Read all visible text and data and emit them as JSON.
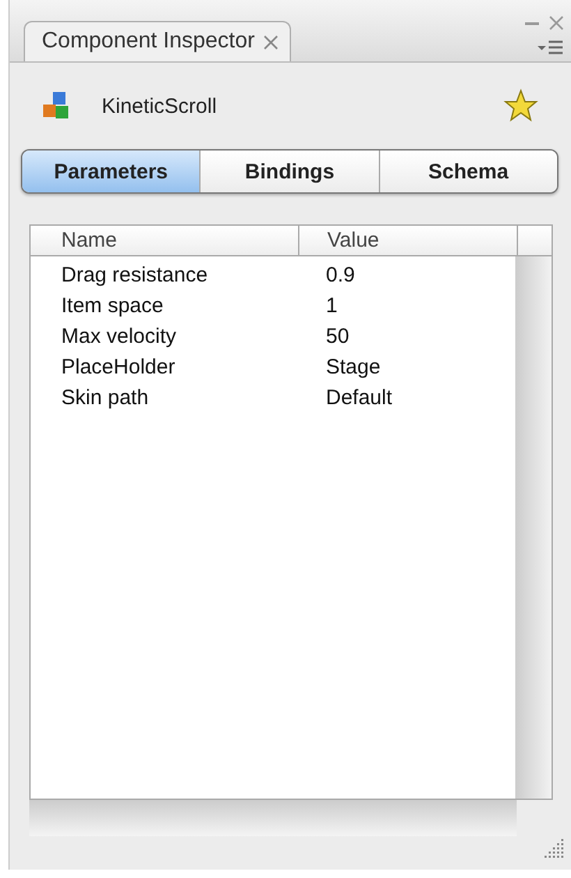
{
  "panel": {
    "tab": "Component Inspector"
  },
  "component": {
    "name": "KineticScroll"
  },
  "tabs": [
    {
      "label": "Parameters",
      "selected": true
    },
    {
      "label": "Bindings",
      "selected": false
    },
    {
      "label": "Schema",
      "selected": false
    }
  ],
  "table": {
    "columns": [
      "Name",
      "Value"
    ],
    "rows": [
      {
        "name": "Drag resistance",
        "value": "0.9"
      },
      {
        "name": "Item space",
        "value": "1"
      },
      {
        "name": "Max velocity",
        "value": "50"
      },
      {
        "name": "PlaceHolder",
        "value": "Stage"
      },
      {
        "name": "Skin path",
        "value": "Default"
      }
    ]
  }
}
